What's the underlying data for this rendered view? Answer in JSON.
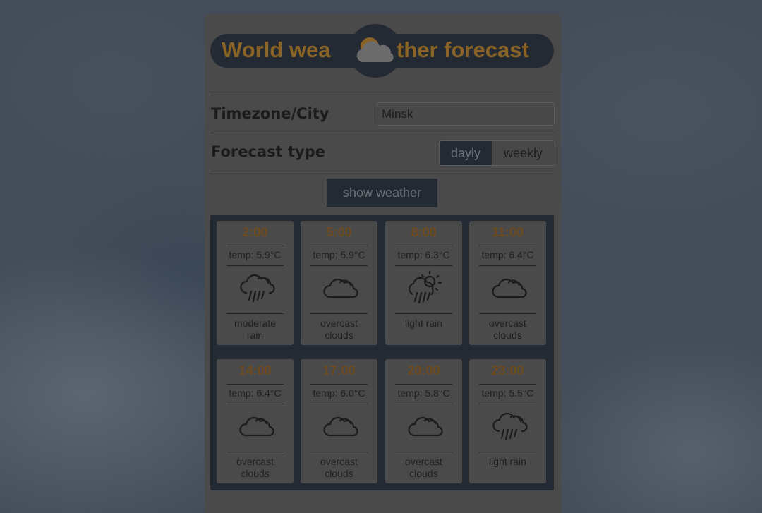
{
  "app": {
    "logo_left": "World wea",
    "logo_right": "ther forecast",
    "logo_icon": "sun-cloud-icon",
    "accent_color": "#8a6426"
  },
  "form": {
    "city_label": "Timezone/City",
    "city_value": "Minsk",
    "forecast_type_label": "Forecast type",
    "forecast_options": [
      "dayly",
      "weekly"
    ],
    "forecast_selected": "dayly",
    "show_button_label": "show weather"
  },
  "forecast": [
    {
      "time": "2:00",
      "temp": "temp: 5.9°C",
      "description": "moderate rain",
      "icon": "rain-cloud-icon"
    },
    {
      "time": "5:00",
      "temp": "temp: 5.9°C",
      "description": "overcast clouds",
      "icon": "cloud-icon"
    },
    {
      "time": "8:00",
      "temp": "temp: 6.3°C",
      "description": "light rain",
      "icon": "sun-rain-icon"
    },
    {
      "time": "11:00",
      "temp": "temp: 6.4°C",
      "description": "overcast clouds",
      "icon": "cloud-icon"
    },
    {
      "time": "14:00",
      "temp": "temp: 6.4°C",
      "description": "overcast clouds",
      "icon": "cloud-icon"
    },
    {
      "time": "17:00",
      "temp": "temp: 6.0°C",
      "description": "overcast clouds",
      "icon": "cloud-icon"
    },
    {
      "time": "20:00",
      "temp": "temp: 5.8°C",
      "description": "overcast clouds",
      "icon": "cloud-icon"
    },
    {
      "time": "23:00",
      "temp": "temp: 5.5°C",
      "description": "light rain",
      "icon": "rain-cloud-icon"
    }
  ]
}
